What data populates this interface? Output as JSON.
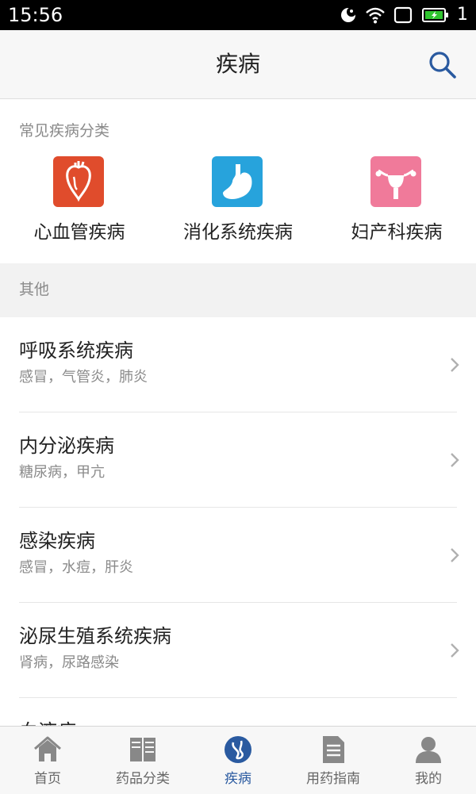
{
  "status_bar": {
    "time": "15:56",
    "battery_level": "1"
  },
  "header": {
    "title": "疾病"
  },
  "common": {
    "label": "常见疾病分类",
    "categories": [
      {
        "label": "心血管疾病",
        "icon": "heart-icon",
        "color": "#e04c2c"
      },
      {
        "label": "消化系统疾病",
        "icon": "stomach-icon",
        "color": "#27a3dc"
      },
      {
        "label": "妇产科疾病",
        "icon": "uterus-icon",
        "color": "#f07a9a"
      }
    ]
  },
  "other": {
    "label": "其他"
  },
  "list": [
    {
      "title": "呼吸系统疾病",
      "subtitle": "感冒，气管炎，肺炎"
    },
    {
      "title": "内分泌疾病",
      "subtitle": "糖尿病，甲亢"
    },
    {
      "title": "感染疾病",
      "subtitle": "感冒，水痘，肝炎"
    },
    {
      "title": "泌尿生殖系统疾病",
      "subtitle": "肾病，尿路感染"
    },
    {
      "title": "血液病",
      "subtitle": ""
    }
  ],
  "nav": [
    {
      "label": "首页",
      "icon": "home-icon"
    },
    {
      "label": "药品分类",
      "icon": "book-icon"
    },
    {
      "label": "疾病",
      "icon": "disease-icon",
      "active": true
    },
    {
      "label": "用药指南",
      "icon": "document-icon"
    },
    {
      "label": "我的",
      "icon": "user-icon"
    }
  ],
  "colors": {
    "accent": "#2a5aa0",
    "muted_text": "#8a8a8a"
  }
}
